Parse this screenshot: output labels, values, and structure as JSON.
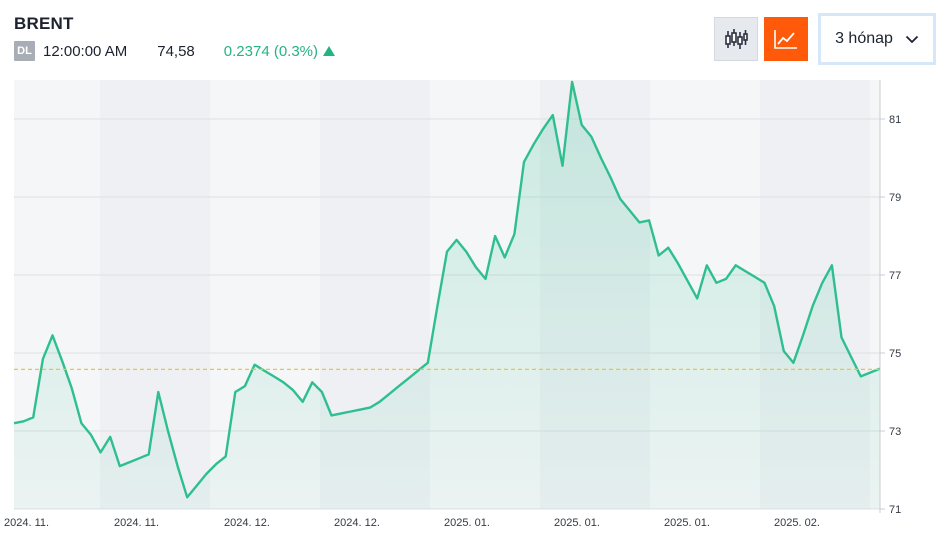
{
  "header": {
    "symbol": "BRENT",
    "badge": "DL",
    "time": "12:00:00 AM",
    "price": "74,58",
    "change": "0.2374 (0.3%)",
    "change_direction": "up",
    "change_color": "#23b384"
  },
  "controls": {
    "candlestick_icon": "candlestick-chart-icon",
    "line_icon": "line-chart-icon",
    "period_label": "3 hónap",
    "accent": "#ff5a0a"
  },
  "chart_data": {
    "type": "area",
    "title": "",
    "xlabel": "",
    "ylabel": "",
    "ylim": [
      71,
      82
    ],
    "yticks": [
      "71",
      "73",
      "75",
      "77",
      "79",
      "81"
    ],
    "xticks": [
      "2024. 11.",
      "2024. 11.",
      "2024. 12.",
      "2024. 12.",
      "2025. 01.",
      "2025. 01.",
      "2025. 01.",
      "2025. 02."
    ],
    "reference_line": 74.58,
    "line_color": "#2fbf8f",
    "reference_color": "#f2c23a",
    "grid": true,
    "series": [
      {
        "values": [
          73.2,
          73.25,
          73.35,
          74.85,
          75.45,
          74.8,
          74.1,
          73.2,
          72.9,
          72.45,
          72.85,
          72.1,
          72.2,
          72.3,
          72.4,
          74.0,
          73.0,
          72.1,
          71.3,
          71.6,
          71.9,
          72.15,
          72.35,
          74.0,
          74.15,
          74.7,
          74.55,
          74.4,
          74.25,
          74.05,
          73.75,
          74.25,
          74.0,
          73.4,
          73.45,
          73.5,
          73.55,
          73.6,
          73.75,
          73.95,
          74.15,
          74.35,
          74.55,
          74.75,
          76.2,
          77.6,
          77.9,
          77.6,
          77.2,
          76.9,
          78.0,
          77.45,
          78.05,
          79.9,
          80.35,
          80.75,
          81.1,
          79.8,
          81.95,
          80.85,
          80.55,
          80.0,
          79.5,
          78.95,
          78.65,
          78.35,
          78.4,
          77.5,
          77.7,
          77.3,
          76.85,
          76.4,
          77.25,
          76.8,
          76.9,
          77.25,
          77.1,
          76.95,
          76.8,
          76.2,
          75.05,
          74.75,
          75.45,
          76.2,
          76.8,
          77.25,
          75.4,
          74.9,
          74.4,
          74.5,
          74.6
        ]
      }
    ]
  }
}
